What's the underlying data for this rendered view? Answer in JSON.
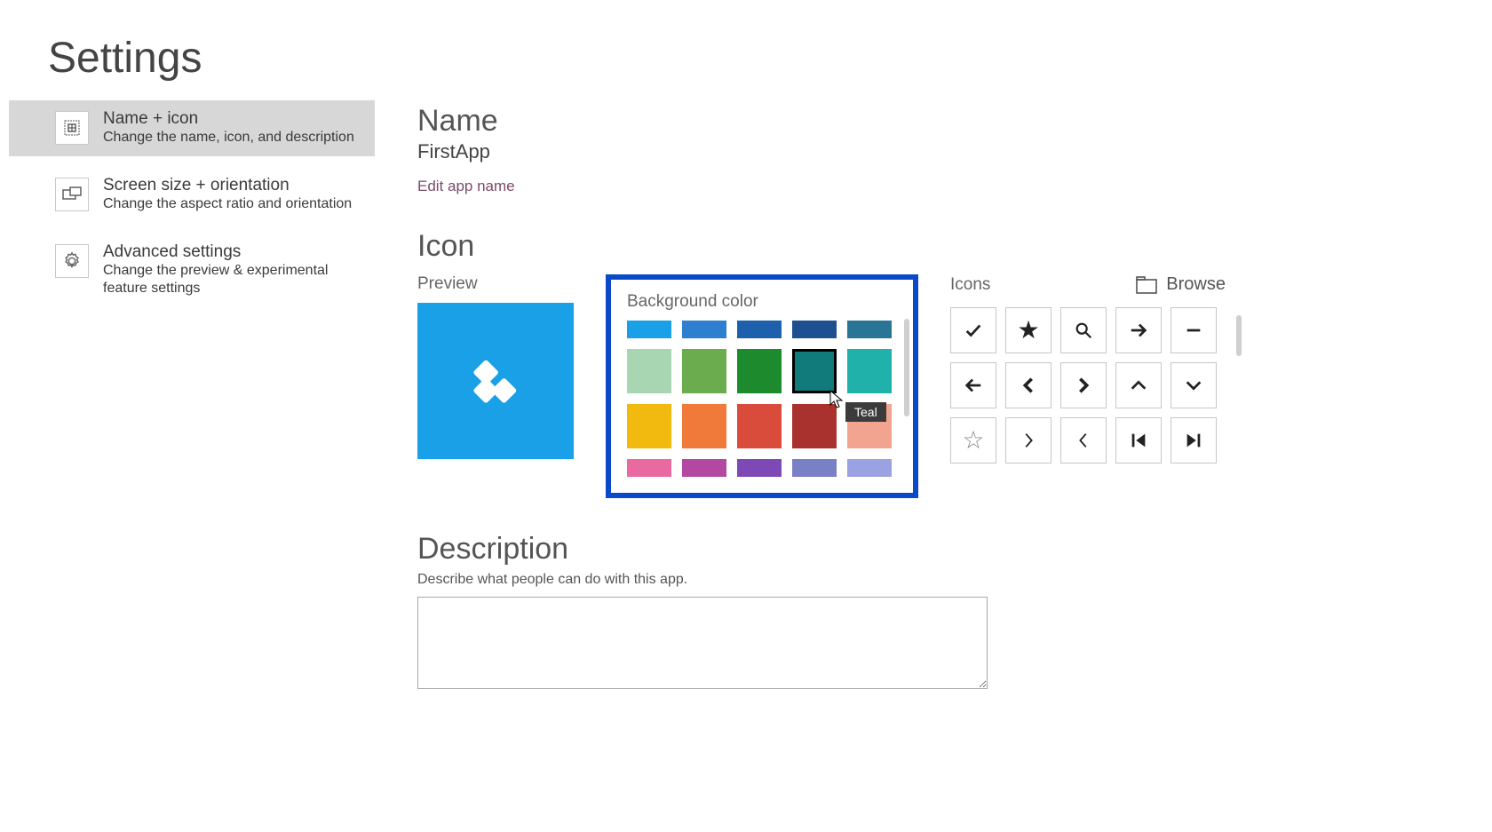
{
  "page_title": "Settings",
  "sidebar": {
    "items": [
      {
        "label": "Name + icon",
        "desc": "Change the name, icon, and description",
        "active": true,
        "icon": "name-icon"
      },
      {
        "label": "Screen size + orientation",
        "desc": "Change the aspect ratio and orientation",
        "active": false,
        "icon": "screen-icon"
      },
      {
        "label": "Advanced settings",
        "desc": "Change the preview & experimental feature settings",
        "active": false,
        "icon": "gear-icon"
      }
    ]
  },
  "main": {
    "name_heading": "Name",
    "app_name": "FirstApp",
    "edit_link": "Edit app name",
    "icon_heading": "Icon",
    "preview_label": "Preview",
    "bgcolor_label": "Background color",
    "icons_label": "Icons",
    "browse_label": "Browse",
    "desc_heading": "Description",
    "desc_hint": "Describe what people can do with this app.",
    "desc_value": "",
    "preview_bg": "#1aa0e6",
    "tooltip_text": "Teal",
    "colors": [
      [
        "#1aa0e6",
        "#2f7fd1",
        "#1d61ad",
        "#1e4f90",
        "#2a7596"
      ],
      [
        "#a8d6b2",
        "#6bad4e",
        "#1e8a2e",
        "#117a7a",
        "#20b2aa"
      ],
      [
        "#f2b90f",
        "#ef7a3a",
        "#d94b3a",
        "#a9322f",
        "#f3a490"
      ],
      [
        "#e86aa0",
        "#b348a1",
        "#7d49b5",
        "#7a80c5",
        "#9aa2e3"
      ]
    ],
    "selected_color": {
      "row": 1,
      "col": 3
    },
    "icons": [
      [
        "check",
        "star",
        "search",
        "arrow-right",
        "minus"
      ],
      [
        "arrow-left",
        "chevron-left-bold",
        "chevron-right-bold",
        "caret-up",
        "caret-down"
      ],
      [
        "star-outline",
        "chevron-right",
        "chevron-left",
        "skip-first",
        "skip-last"
      ]
    ]
  }
}
